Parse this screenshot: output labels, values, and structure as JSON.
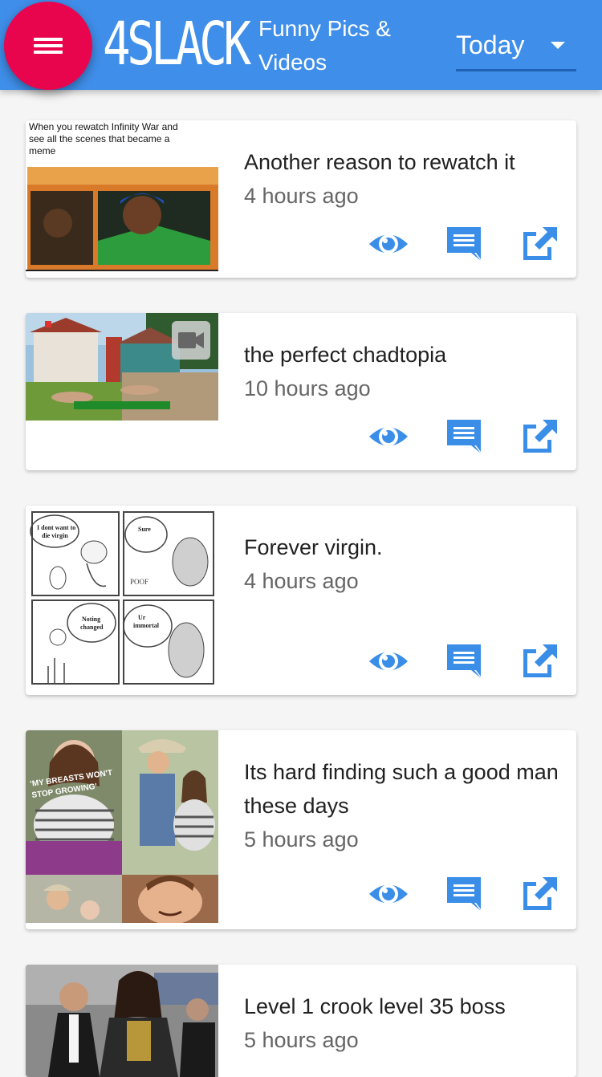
{
  "header": {
    "logo": "4SLACK",
    "tagline_line1": "Funny Pics &",
    "tagline_line2": "Videos",
    "filter_value": "Today",
    "menu_icon": "hamburger-menu-icon",
    "accent_color": "#3f8ee9",
    "fab_color": "#e8054e"
  },
  "thumbnails": {
    "post1_caption": "When you rewatch Infinity War and see all the scenes that became a meme",
    "post3_bubble1": "I dont want to die virgin",
    "post3_bubble2": "Sure",
    "post3_bubble3": "Nothing changed",
    "post3_bubble4": "Ur immortal",
    "post3_sfx": "POOF",
    "post4_banner": "'MY BREASTS WON'T STOP GROWING'"
  },
  "posts": [
    {
      "title": "Another reason to rewatch it",
      "time": "4 hours ago"
    },
    {
      "title": "the perfect chadtopia",
      "time": "10 hours ago"
    },
    {
      "title": "Forever virgin.",
      "time": "4 hours ago"
    },
    {
      "title": "Its hard finding such a good man these days",
      "time": "5 hours ago"
    },
    {
      "title": "Level 1 crook level 35 boss",
      "time": "5 hours ago"
    }
  ],
  "icons": {
    "view": "eye-icon",
    "comment": "comment-icon",
    "share": "open-external-icon",
    "video": "video-camera-icon"
  },
  "icon_color": "#3a8ee8"
}
